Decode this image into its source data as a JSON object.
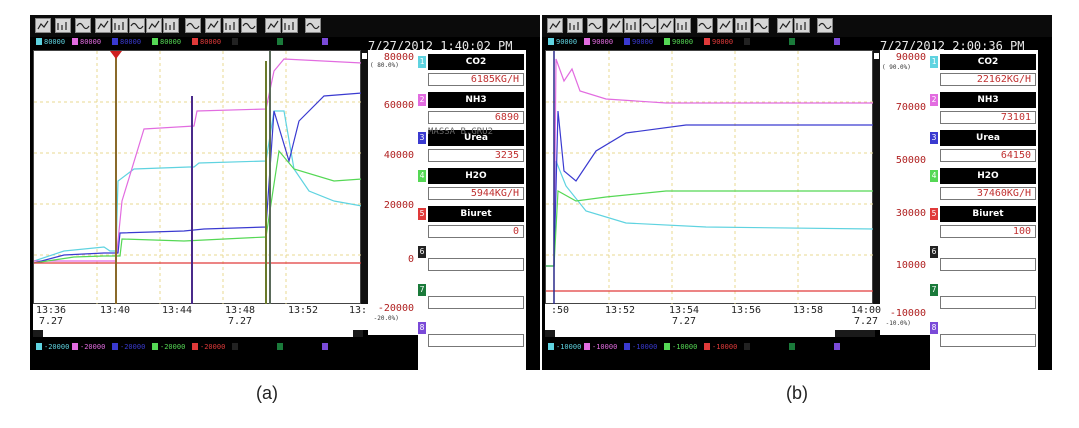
{
  "panels": [
    {
      "id": "a",
      "datetime": "7/27/2012 1:40:02 PM",
      "top_scale": [
        "80000",
        "80000",
        "80000",
        "80000",
        "80000"
      ],
      "bottom_scale": [
        "-20000",
        "-20000",
        "-20000",
        "-20000",
        "-20000"
      ],
      "channel_numbers": [
        "1",
        "2",
        "3",
        "4",
        "5",
        "6",
        "7",
        "8"
      ],
      "y_labels": [
        "80000",
        "60000",
        "40000",
        "20000",
        "0",
        "-20000"
      ],
      "y_top_percent": "( 80.0%)",
      "y_bottom_percent": "(-20.0%)",
      "x_ticks": [
        "13:36",
        "13:40",
        "13:44",
        "13:48",
        "13:52",
        "13:"
      ],
      "x_dates": [
        "7.27",
        "7.27"
      ],
      "tags": [
        {
          "name": "CO2",
          "value": "6185KG/H"
        },
        {
          "name": "NH3",
          "value": "6890"
        },
        {
          "name": "Urea",
          "value": "3235"
        },
        {
          "name": "H2O",
          "value": "5944KG/H"
        },
        {
          "name": "Biuret",
          "value": "0"
        }
      ],
      "ghost_text": "MASSA B.GRU2",
      "caption": "(a)"
    },
    {
      "id": "b",
      "datetime": "7/27/2012 2:00:36 PM",
      "top_scale": [
        "90000",
        "90000",
        "90000",
        "90000",
        "90000"
      ],
      "bottom_scale": [
        "-10000",
        "-10000",
        "-10000",
        "-10000",
        "-10000"
      ],
      "channel_numbers": [
        "1",
        "2",
        "3",
        "4",
        "5",
        "6",
        "7",
        "8"
      ],
      "y_labels": [
        "90000",
        "70000",
        "50000",
        "30000",
        "10000",
        "-10000"
      ],
      "y_top_percent": "( 90.0%)",
      "y_bottom_percent": "(-10.0%)",
      "x_ticks": [
        ":50",
        "13:52",
        "13:54",
        "13:56",
        "13:58",
        "14:00"
      ],
      "x_dates": [
        "7.27",
        "7.27"
      ],
      "tags": [
        {
          "name": "CO2",
          "value": "22162KG/H"
        },
        {
          "name": "NH3",
          "value": "73101"
        },
        {
          "name": "Urea",
          "value": "64150"
        },
        {
          "name": "H2O",
          "value": "37460KG/H"
        },
        {
          "name": "Biuret",
          "value": "100"
        }
      ],
      "caption": "(b)"
    }
  ],
  "colors": {
    "ch1": "#5fd3e0",
    "ch2": "#e26ce0",
    "ch3": "#3a3ad0",
    "ch4": "#55d855",
    "ch5": "#e03a3a",
    "ch6": "#222222",
    "ch7": "#1a7a3a",
    "ch8": "#7a4ad8",
    "grid": "#e8d890",
    "value_text": "#c03030"
  },
  "toolbar_icons": [
    "print-icon",
    "check-icon",
    "trend-icon",
    "multi-trend-icon",
    "bar-icon",
    "bar2-icon",
    "digital-icon",
    "digital2-icon",
    "overview-icon",
    "wave-icon",
    "database-icon",
    "settings-icon",
    "history-icon",
    "compare-icon",
    "signal-icon"
  ]
}
